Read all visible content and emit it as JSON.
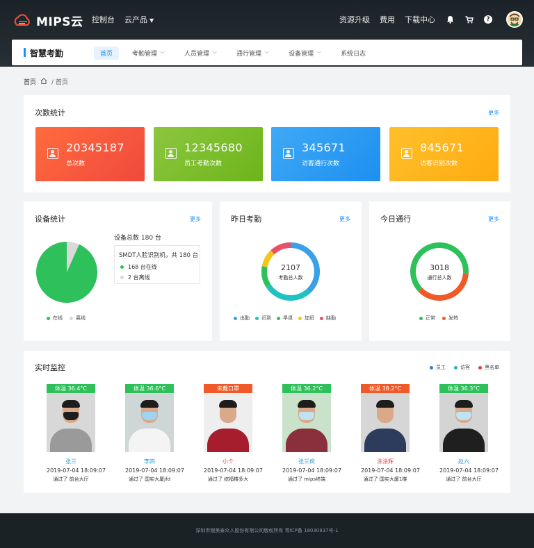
{
  "topbar": {
    "logo": "MIPS云",
    "nav": [
      {
        "label": "控制台",
        "caret": false
      },
      {
        "label": "云产品",
        "caret": true
      }
    ],
    "right": [
      "资源升级",
      "费用",
      "下载中心"
    ]
  },
  "appbar": {
    "title": "智慧考勤",
    "nav": [
      {
        "label": "首页",
        "active": true,
        "chevron": false
      },
      {
        "label": "考勤管理",
        "active": false,
        "chevron": true
      },
      {
        "label": "人员管理",
        "active": false,
        "chevron": true
      },
      {
        "label": "通行管理",
        "active": false,
        "chevron": true
      },
      {
        "label": "设备管理",
        "active": false,
        "chevron": true
      },
      {
        "label": "系统日志",
        "active": false,
        "chevron": false
      }
    ]
  },
  "breadcrumb": {
    "root": "首页",
    "current": "/ 首页"
  },
  "counts": {
    "title": "次数统计",
    "more": "更多",
    "cards": [
      {
        "value": "20345187",
        "label": "总次数",
        "color_from": "#ff6b3d",
        "color_to": "#f0493d"
      },
      {
        "value": "12345680",
        "label": "员工考勤次数",
        "color_from": "#8cc63f",
        "color_to": "#6cb51a"
      },
      {
        "value": "345671",
        "label": "访客通行次数",
        "color_from": "#3fa9f5",
        "color_to": "#1d8ff0"
      },
      {
        "value": "845671",
        "label": "访客识别次数",
        "color_from": "#ffc02b",
        "color_to": "#ffab10"
      }
    ]
  },
  "devices": {
    "title": "设备统计",
    "more": "更多",
    "total_label": "设备总数 180 台",
    "box_title": "SMDT人脸识别机，共 180 台",
    "online": "168 台在线",
    "offline": "2 台离线",
    "legend": [
      "在线",
      "离线"
    ]
  },
  "attendance": {
    "title": "昨日考勤",
    "more": "更多",
    "center_value": "2107",
    "center_label": "考勤总人数",
    "legend": [
      "出勤",
      "迟到",
      "早退",
      "加班",
      "缺勤"
    ]
  },
  "traffic": {
    "title": "今日通行",
    "more": "更多",
    "center_value": "3018",
    "center_label": "通行总人数",
    "legend": [
      "正常",
      "发热"
    ]
  },
  "monitor": {
    "title": "实时监控",
    "legend": [
      "员工",
      "访客",
      "黑名单"
    ],
    "people": [
      {
        "tag": "体温 36.4°C",
        "tag_color": "#2ec05a",
        "name": "张三",
        "name_color": "#2ea0d8",
        "time": "2019-07-04 18:09:07",
        "loc": "通过了 前台大厅",
        "mask": true,
        "mask_color": "#1d1d1d",
        "shirt": "#9a9a9a",
        "wall": "#d8d8d8"
      },
      {
        "tag": "体温 36.6°C",
        "tag_color": "#2ec05a",
        "name": "李四",
        "name_color": "#2ea0d8",
        "time": "2019-07-04 18:09:07",
        "loc": "通过了 国实大厦jfd",
        "mask": true,
        "mask_color": "#9fd3ef",
        "shirt": "#f4f4f4",
        "wall": "#cfd6d6"
      },
      {
        "tag": "未戴口罩",
        "tag_color": "#f05a28",
        "name": "小个",
        "name_color": "#e03a3a",
        "time": "2019-07-04 18:09:07",
        "loc": "通过了 综福楼多大",
        "mask": false,
        "mask_color": "",
        "shirt": "#a61e2e",
        "wall": "#eeeeee"
      },
      {
        "tag": "体温 36.2°C",
        "tag_color": "#2ec05a",
        "name": "张三疯",
        "name_color": "#2ea0d8",
        "time": "2019-07-04 18:09:07",
        "loc": "通过了 mips终端",
        "mask": true,
        "mask_color": "#bfe2f5",
        "shirt": "#8a2f3c",
        "wall": "#c9e2c9"
      },
      {
        "tag": "体温 38.2°C",
        "tag_color": "#f05a28",
        "name": "涂涂辉",
        "name_color": "#e03a3a",
        "time": "2019-07-04 18:09:07",
        "loc": "通过了 国实大厦1楼",
        "mask": false,
        "mask_color": "",
        "shirt": "#2d3b5c",
        "wall": "#d6d6d6"
      },
      {
        "tag": "体温 36.3°C",
        "tag_color": "#2ec05a",
        "name": "赵六",
        "name_color": "#2ea0d8",
        "time": "2019-07-04 18:09:07",
        "loc": "通过了 前台大厅",
        "mask": true,
        "mask_color": "#bfe2f5",
        "shirt": "#1f1f1f",
        "wall": "#d4d4d4"
      }
    ]
  },
  "footer": "深圳市银美泰众人股份有限公司版权所有 粤ICP备 18030837号-1",
  "colors": {
    "accent": "#1890ff",
    "green": "#2ec05a",
    "orange": "#f05a28",
    "gray": "#d9d9d9"
  },
  "chart_data": [
    {
      "type": "pie",
      "labels": [
        "在线",
        "离线"
      ],
      "values": [
        168,
        12
      ],
      "colors": [
        "#2ec05a",
        "#d9d9d9"
      ]
    },
    {
      "type": "pie",
      "labels": [
        "出勤",
        "迟到",
        "早退",
        "加班",
        "缺勤"
      ],
      "values": [
        38,
        28,
        12,
        10,
        12
      ],
      "colors": [
        "#3aa0e8",
        "#1fc2c2",
        "#2ec05a",
        "#f5c518",
        "#e8506a"
      ]
    },
    {
      "type": "pie",
      "labels": [
        "正常",
        "发热"
      ],
      "values": [
        63,
        37
      ],
      "colors": [
        "#2ec05a",
        "#f05a28"
      ]
    }
  ]
}
